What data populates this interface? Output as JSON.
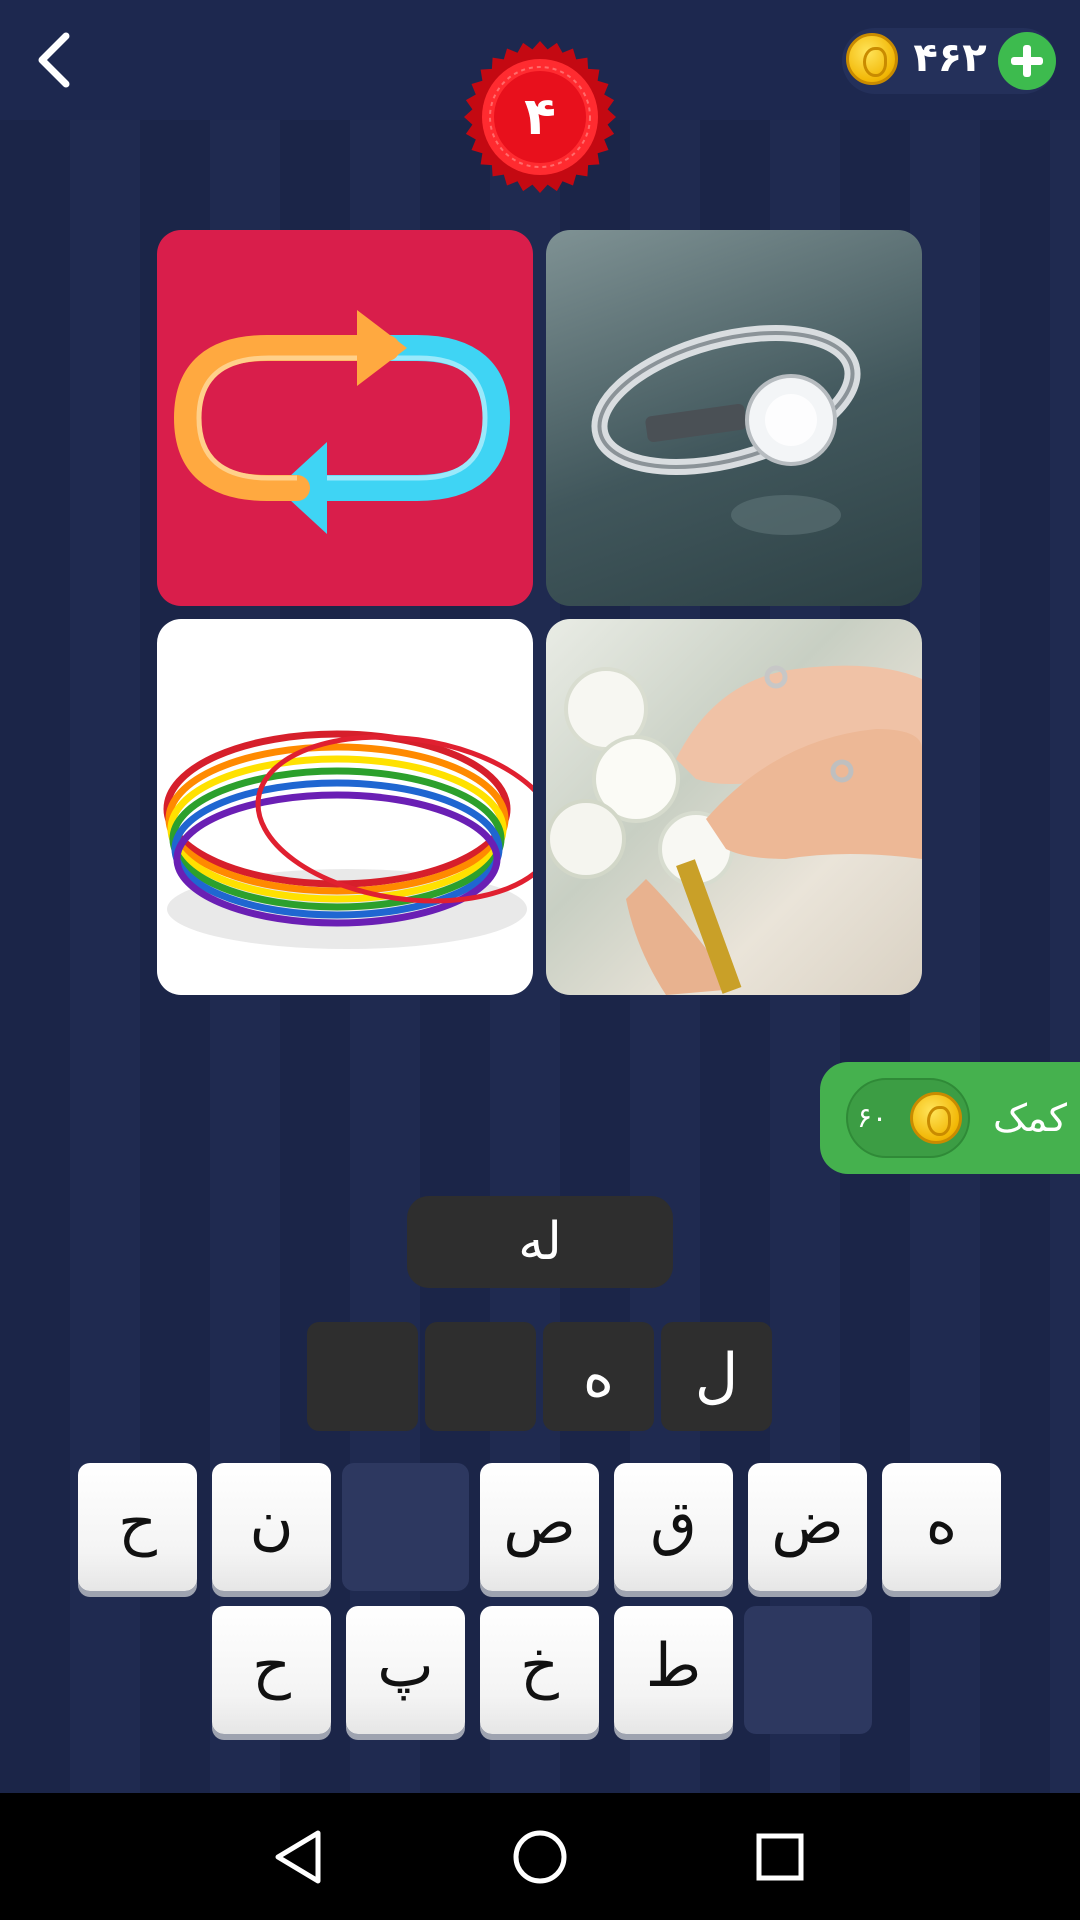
{
  "header": {
    "level": "۴",
    "coins": "۴۶۲",
    "icons": {
      "back": "chevron-left-icon",
      "coin": "coin-icon",
      "add": "plus-icon"
    }
  },
  "puzzle": {
    "images": [
      {
        "name": "repeat-arrows-image",
        "background": "#d91e4b"
      },
      {
        "name": "diamond-ring-image"
      },
      {
        "name": "rainbow-bangles-image"
      },
      {
        "name": "wedding-hands-image"
      }
    ]
  },
  "hint": {
    "label": "کمک",
    "cost": "۶۰"
  },
  "partial_word": "له",
  "answer_slots": [
    "",
    "",
    "ه",
    "ل"
  ],
  "keyboard": {
    "row1": [
      "ح",
      "ن",
      "",
      "ص",
      "ق",
      "ض",
      "ه"
    ],
    "row2": [
      "ح",
      "پ",
      "خ",
      "ط",
      ""
    ]
  },
  "colors": {
    "background": "#1b2548",
    "badge_red": "#e8101c",
    "hint_green": "#45b14e",
    "slot_dark": "#2e2e2e"
  },
  "system_nav": {
    "back": "triangle-back-icon",
    "home": "circle-home-icon",
    "recents": "square-recents-icon"
  }
}
